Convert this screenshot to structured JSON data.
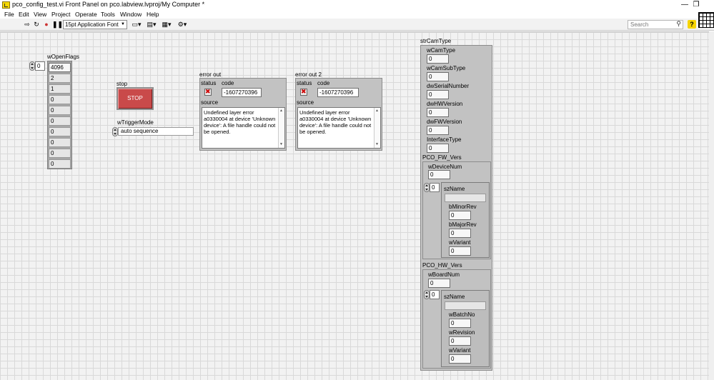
{
  "window": {
    "title": "pco_config_test.vi Front Panel on pco.labview.lvproj/My Computer *",
    "minimize": "—",
    "restore": "❐"
  },
  "menu": [
    "File",
    "Edit",
    "View",
    "Project",
    "Operate",
    "Tools",
    "Window",
    "Help"
  ],
  "toolbar": {
    "font": "15pt Application Font",
    "search_placeholder": "Search",
    "help": "?"
  },
  "w_open_flags": {
    "label": "wOpenFlags",
    "index": "0",
    "values": [
      "4096",
      "2",
      "1",
      "0",
      "0",
      "0",
      "0",
      "0",
      "0",
      "0"
    ]
  },
  "stop": {
    "label": "stop",
    "button": "STOP"
  },
  "trigger": {
    "label": "wTriggerMode",
    "value": "auto sequence"
  },
  "error_out": {
    "label": "error out",
    "status_label": "status",
    "code_label": "code",
    "code": "-1607270396",
    "source_label": "source",
    "source": "Undefined layer error a0330004 at device 'Unknown device': A file handle could not be opened."
  },
  "error_out_2": {
    "label": "error out 2",
    "status_label": "status",
    "code_label": "code",
    "code": "-1607270396",
    "source_label": "source",
    "source": "Undefined layer error a0330004 at device 'Unknown device': A file handle could not be opened."
  },
  "cam_type": {
    "label": "strCamType",
    "fields": [
      {
        "label": "wCamType",
        "value": "0"
      },
      {
        "label": "wCamSubType",
        "value": "0"
      },
      {
        "label": "dwSerialNumber",
        "value": "0"
      },
      {
        "label": "dwHWVersion",
        "value": "0"
      },
      {
        "label": "dwFWVersion",
        "value": "0"
      },
      {
        "label": "InterfaceType",
        "value": "0"
      }
    ],
    "fw_vers": {
      "label": "PCO_FW_Vers",
      "count_label": "wDeviceNum",
      "count": "0",
      "index": "0",
      "name_label": "szName",
      "name": "",
      "fields": [
        {
          "label": "bMinorRev",
          "value": "0"
        },
        {
          "label": "bMajorRev",
          "value": "0"
        },
        {
          "label": "wVariant",
          "value": "0"
        }
      ]
    },
    "hw_vers": {
      "label": "PCO_HW_Vers",
      "count_label": "wBoardNum",
      "count": "0",
      "index": "0",
      "name_label": "szName",
      "name": "",
      "fields": [
        {
          "label": "wBatchNo",
          "value": "0"
        },
        {
          "label": "wRevision",
          "value": "0"
        },
        {
          "label": "wVariant",
          "value": "0"
        }
      ]
    }
  }
}
